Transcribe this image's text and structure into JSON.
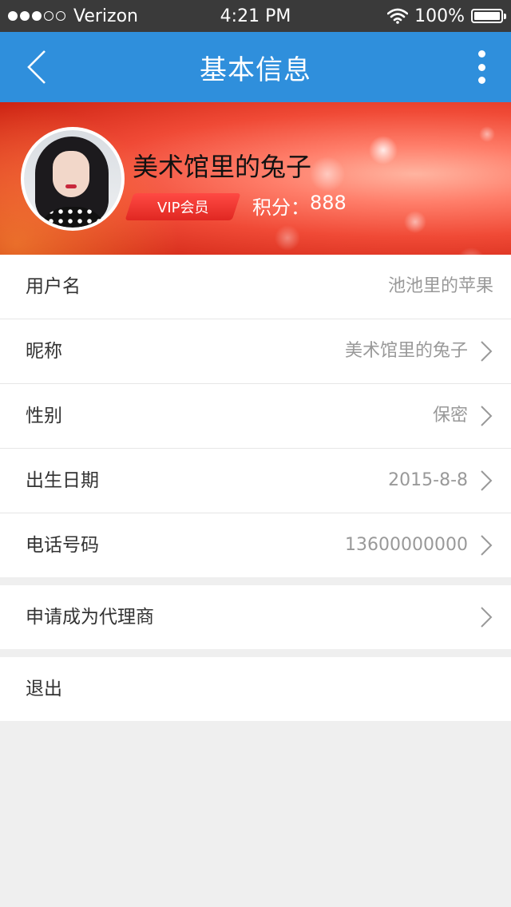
{
  "status_bar": {
    "carrier": "Verizon",
    "time": "4:21 PM",
    "battery": "100%",
    "signal_bars_filled": 3,
    "signal_bars_total": 5
  },
  "nav": {
    "title": "基本信息",
    "back_icon": "back-chevron-icon",
    "more_icon": "more-vertical-icon",
    "color": "#2f8fdc"
  },
  "profile": {
    "name": "美术馆里的兔子",
    "vip_label": "VIP会员",
    "points_label": "积分：",
    "points_value": "888"
  },
  "rows": [
    {
      "label": "用户名",
      "value": "池池里的苹果"
    },
    {
      "label": "昵称",
      "value": "美术馆里的兔子"
    },
    {
      "label": "性别",
      "value": "保密"
    },
    {
      "label": "出生日期",
      "value": "2015-8-8"
    },
    {
      "label": "电话号码",
      "value": "13600000000"
    }
  ],
  "agent": {
    "label": "申请成为代理商"
  },
  "logout": {
    "label": "退出"
  }
}
